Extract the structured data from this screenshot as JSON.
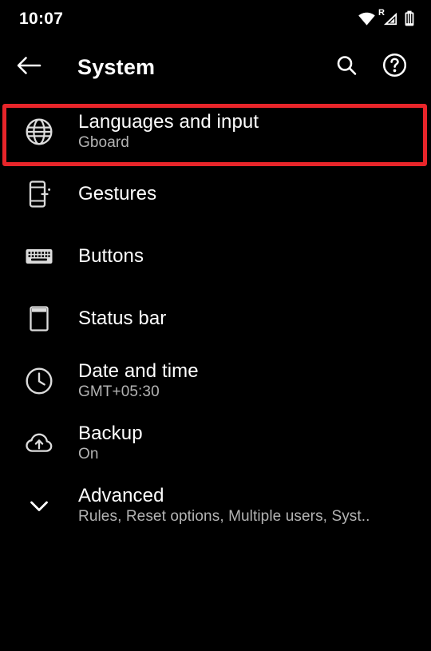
{
  "status_bar": {
    "time": "10:07",
    "icons": [
      {
        "name": "wifi-icon",
        "label": "Wi-Fi"
      },
      {
        "name": "cellular-signal-roaming-icon",
        "label": "R"
      },
      {
        "name": "battery-icon",
        "label": "Battery"
      }
    ]
  },
  "app_bar": {
    "back_label": "Back",
    "title": "System",
    "search_label": "Search",
    "help_label": "Help"
  },
  "highlight": {
    "color": "#e8252a",
    "target": "Languages and input"
  },
  "settings": {
    "items": [
      {
        "id": "languages-and-input",
        "icon": "globe-icon",
        "title": "Languages and input",
        "subtitle": "Gboard",
        "highlighted": true
      },
      {
        "id": "gestures",
        "icon": "phone-gesture-icon",
        "title": "Gestures",
        "subtitle": "",
        "highlighted": false
      },
      {
        "id": "buttons",
        "icon": "keyboard-icon",
        "title": "Buttons",
        "subtitle": "",
        "highlighted": false
      },
      {
        "id": "status-bar",
        "icon": "status-bar-icon",
        "title": "Status bar",
        "subtitle": "",
        "highlighted": false
      },
      {
        "id": "date-and-time",
        "icon": "clock-icon",
        "title": "Date and time",
        "subtitle": "GMT+05:30",
        "highlighted": false
      },
      {
        "id": "backup",
        "icon": "cloud-upload-icon",
        "title": "Backup",
        "subtitle": "On",
        "highlighted": false
      },
      {
        "id": "advanced",
        "icon": "chevron-down-icon",
        "title": "Advanced",
        "subtitle": "Rules, Reset options, Multiple users, Syst..",
        "highlighted": false
      }
    ]
  },
  "theme": {
    "background": "#000000",
    "primary_text": "#ffffff",
    "secondary_text": "#b3b3b3",
    "highlight": "#e8252a"
  }
}
